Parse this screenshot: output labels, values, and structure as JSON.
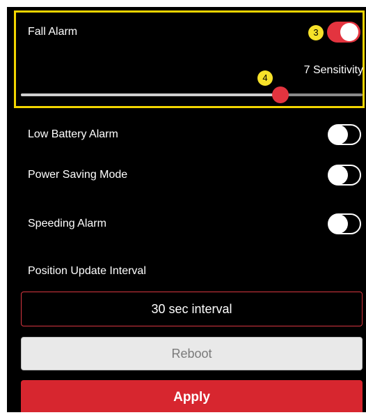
{
  "fall_alarm": {
    "label": "Fall Alarm",
    "enabled": true,
    "badge": "3",
    "sensitivity": 7,
    "sensitivity_text": "7 Sensitivity",
    "slider_fraction": 0.76,
    "slider_badge": "4"
  },
  "toggles": [
    {
      "label": "Low Battery Alarm",
      "enabled": false
    },
    {
      "label": "Power Saving Mode",
      "enabled": false
    },
    {
      "label": "Speeding Alarm",
      "enabled": false
    }
  ],
  "position_update": {
    "label": "Position Update Interval",
    "value": "30 sec interval"
  },
  "buttons": {
    "reboot": "Reboot",
    "apply": "Apply"
  },
  "colors": {
    "accent": "#e3343f",
    "apply": "#d7262f",
    "highlight": "#f2d500",
    "badge": "#f7e22a"
  }
}
